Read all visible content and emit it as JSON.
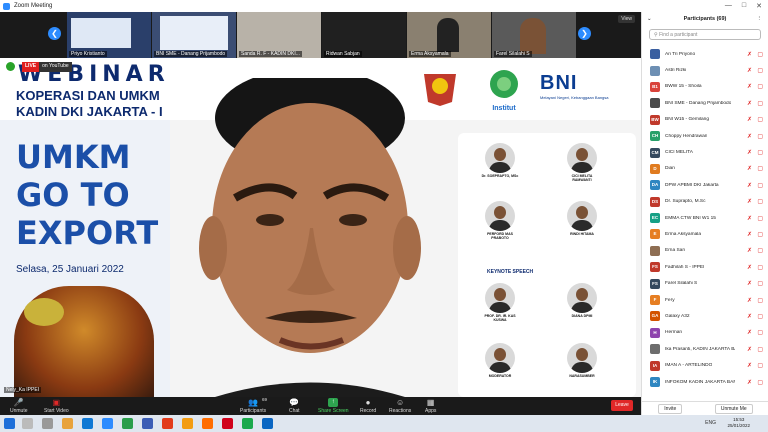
{
  "window": {
    "title": "Zoom Meeting",
    "view_label": "View"
  },
  "thumbnails": [
    {
      "name": "Priyo Kristianto"
    },
    {
      "name": "BNI SME - Danang Prijambodo"
    },
    {
      "name": "Sanda R. F - KADIN DKI..."
    },
    {
      "name": "Ridwan Sabjan"
    },
    {
      "name": "Erma Aksyamala"
    },
    {
      "name": "Farel Silalahi S"
    }
  ],
  "live": {
    "live_label": "LIVE",
    "platform_label": "on YouTube"
  },
  "slide": {
    "webinar": "WEBINAR",
    "line1": "KOPERASI DAN UMKM",
    "line2": "KADIN DKI JAKARTA - I",
    "umkm_lines": [
      "UMKM",
      "GO TO",
      "EXPORT"
    ],
    "date": "Selasa, 25 Januari 2022",
    "bni": "BNI",
    "bni_tagline": "Melayani Negeri, Kebanggaan Bangsa",
    "institut": "Institut",
    "keynote": "KEYNOTE SPEECH"
  },
  "speakers": [
    {
      "name": "Dr. SOEPRAPTO, MSc"
    },
    {
      "name": "CICI MELITA RAMWANTI"
    },
    {
      "name": "PERFORD MAS PRABOTO"
    },
    {
      "name": "RINDI HITAMA"
    },
    {
      "name": "PROF. DR. IR. KAS KUSWA"
    },
    {
      "name": "DIANA DPMI"
    },
    {
      "name": "MODERATOR"
    },
    {
      "name": "NARASUMBER"
    }
  ],
  "self_name": "Nely_Ka IPPEI",
  "toolbar": {
    "unmute": "Unmute",
    "start_video": "Start Video",
    "participants": "Participants",
    "participants_count": "69",
    "chat": "Chat",
    "share_screen": "Share Screen",
    "record": "Record",
    "reactions": "Reactions",
    "apps": "Apps",
    "end": "Leave"
  },
  "panel": {
    "title": "Participants (69)",
    "search_placeholder": "Find a participant",
    "invite": "Invite",
    "unmute_me": "Unmute Me",
    "participants": [
      {
        "initials": "",
        "name": "Ari Tri Priyono",
        "color": "#3a5fa0"
      },
      {
        "initials": "",
        "name": "Astri Rizki",
        "color": "#6d8fb3"
      },
      {
        "initials": "B1",
        "name": "BWW 15 - Shoila",
        "color": "#d9433b"
      },
      {
        "initials": "",
        "name": "BNI SME - Danang Prijambodo",
        "color": "#4a4a4a"
      },
      {
        "initials": "BW",
        "name": "BNI W15 - Gemilang",
        "color": "#c0392b"
      },
      {
        "initials": "CH",
        "name": "Choppy Hendrawan",
        "color": "#27a06a"
      },
      {
        "initials": "CM",
        "name": "CICI MELITA",
        "color": "#34495e"
      },
      {
        "initials": "D",
        "name": "Dian",
        "color": "#e07b1f"
      },
      {
        "initials": "DA",
        "name": "DPW APBMI DKI Jakarta",
        "color": "#2e86c1"
      },
      {
        "initials": "DS",
        "name": "Dr. Suprapto, M.Sc",
        "color": "#c0392b"
      },
      {
        "initials": "EC",
        "name": "EMMA CTW BNI W1 15",
        "color": "#16a085"
      },
      {
        "initials": "E",
        "name": "Erma Aksyamala",
        "color": "#e67e22"
      },
      {
        "initials": "",
        "name": "Erna Sari",
        "color": "#8e6e53"
      },
      {
        "initials": "FS",
        "name": "Fadhilah S - IPPEI",
        "color": "#c0392b"
      },
      {
        "initials": "FS",
        "name": "Farel Silalahi S",
        "color": "#34495e"
      },
      {
        "initials": "F",
        "name": "Fery",
        "color": "#e67e22"
      },
      {
        "initials": "GA",
        "name": "Galaxy A32",
        "color": "#d35400"
      },
      {
        "initials": "H",
        "name": "Herman",
        "color": "#8e44ad"
      },
      {
        "initials": "",
        "name": "Ika Prasanti, KADIN JAKARTA BA...",
        "color": "#6d6d6d"
      },
      {
        "initials": "IA",
        "name": "IMAN A - ARTELINDO",
        "color": "#c0392b"
      },
      {
        "initials": "IK",
        "name": "INFOKOM KADIN JAKARTA BAR...",
        "color": "#2e86c1"
      }
    ]
  },
  "taskbar": {
    "time": "15:53",
    "date": "25/01/2022",
    "lang": "ENG"
  }
}
